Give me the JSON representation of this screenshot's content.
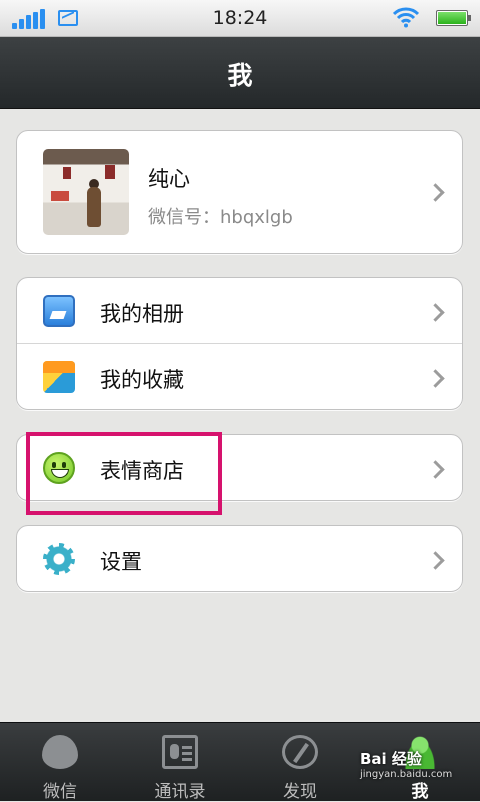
{
  "status_bar": {
    "time": "18:24"
  },
  "header": {
    "title": "我"
  },
  "profile": {
    "name": "纯心",
    "wechat_id": "微信号：hbqxlgb"
  },
  "menu_group_1": [
    {
      "label": "我的相册",
      "icon": "photo-album-icon"
    },
    {
      "label": "我的收藏",
      "icon": "favorites-box-icon"
    }
  ],
  "sticker_store": {
    "label": "表情商店",
    "icon": "smiley-icon"
  },
  "settings": {
    "label": "设置",
    "icon": "gear-icon"
  },
  "tabs": [
    {
      "label": "微信",
      "icon": "chat-bubble-icon"
    },
    {
      "label": "通讯录",
      "icon": "contacts-card-icon"
    },
    {
      "label": "发现",
      "icon": "compass-icon"
    },
    {
      "label": "我",
      "icon": "person-icon",
      "active": true
    }
  ],
  "watermark": {
    "line1": "Bai 经验",
    "line2": "jingyan.baidu.com"
  },
  "colors": {
    "highlight": "#d6126d",
    "accent": "#2a8ff0",
    "titlebar": "#2f3335"
  }
}
